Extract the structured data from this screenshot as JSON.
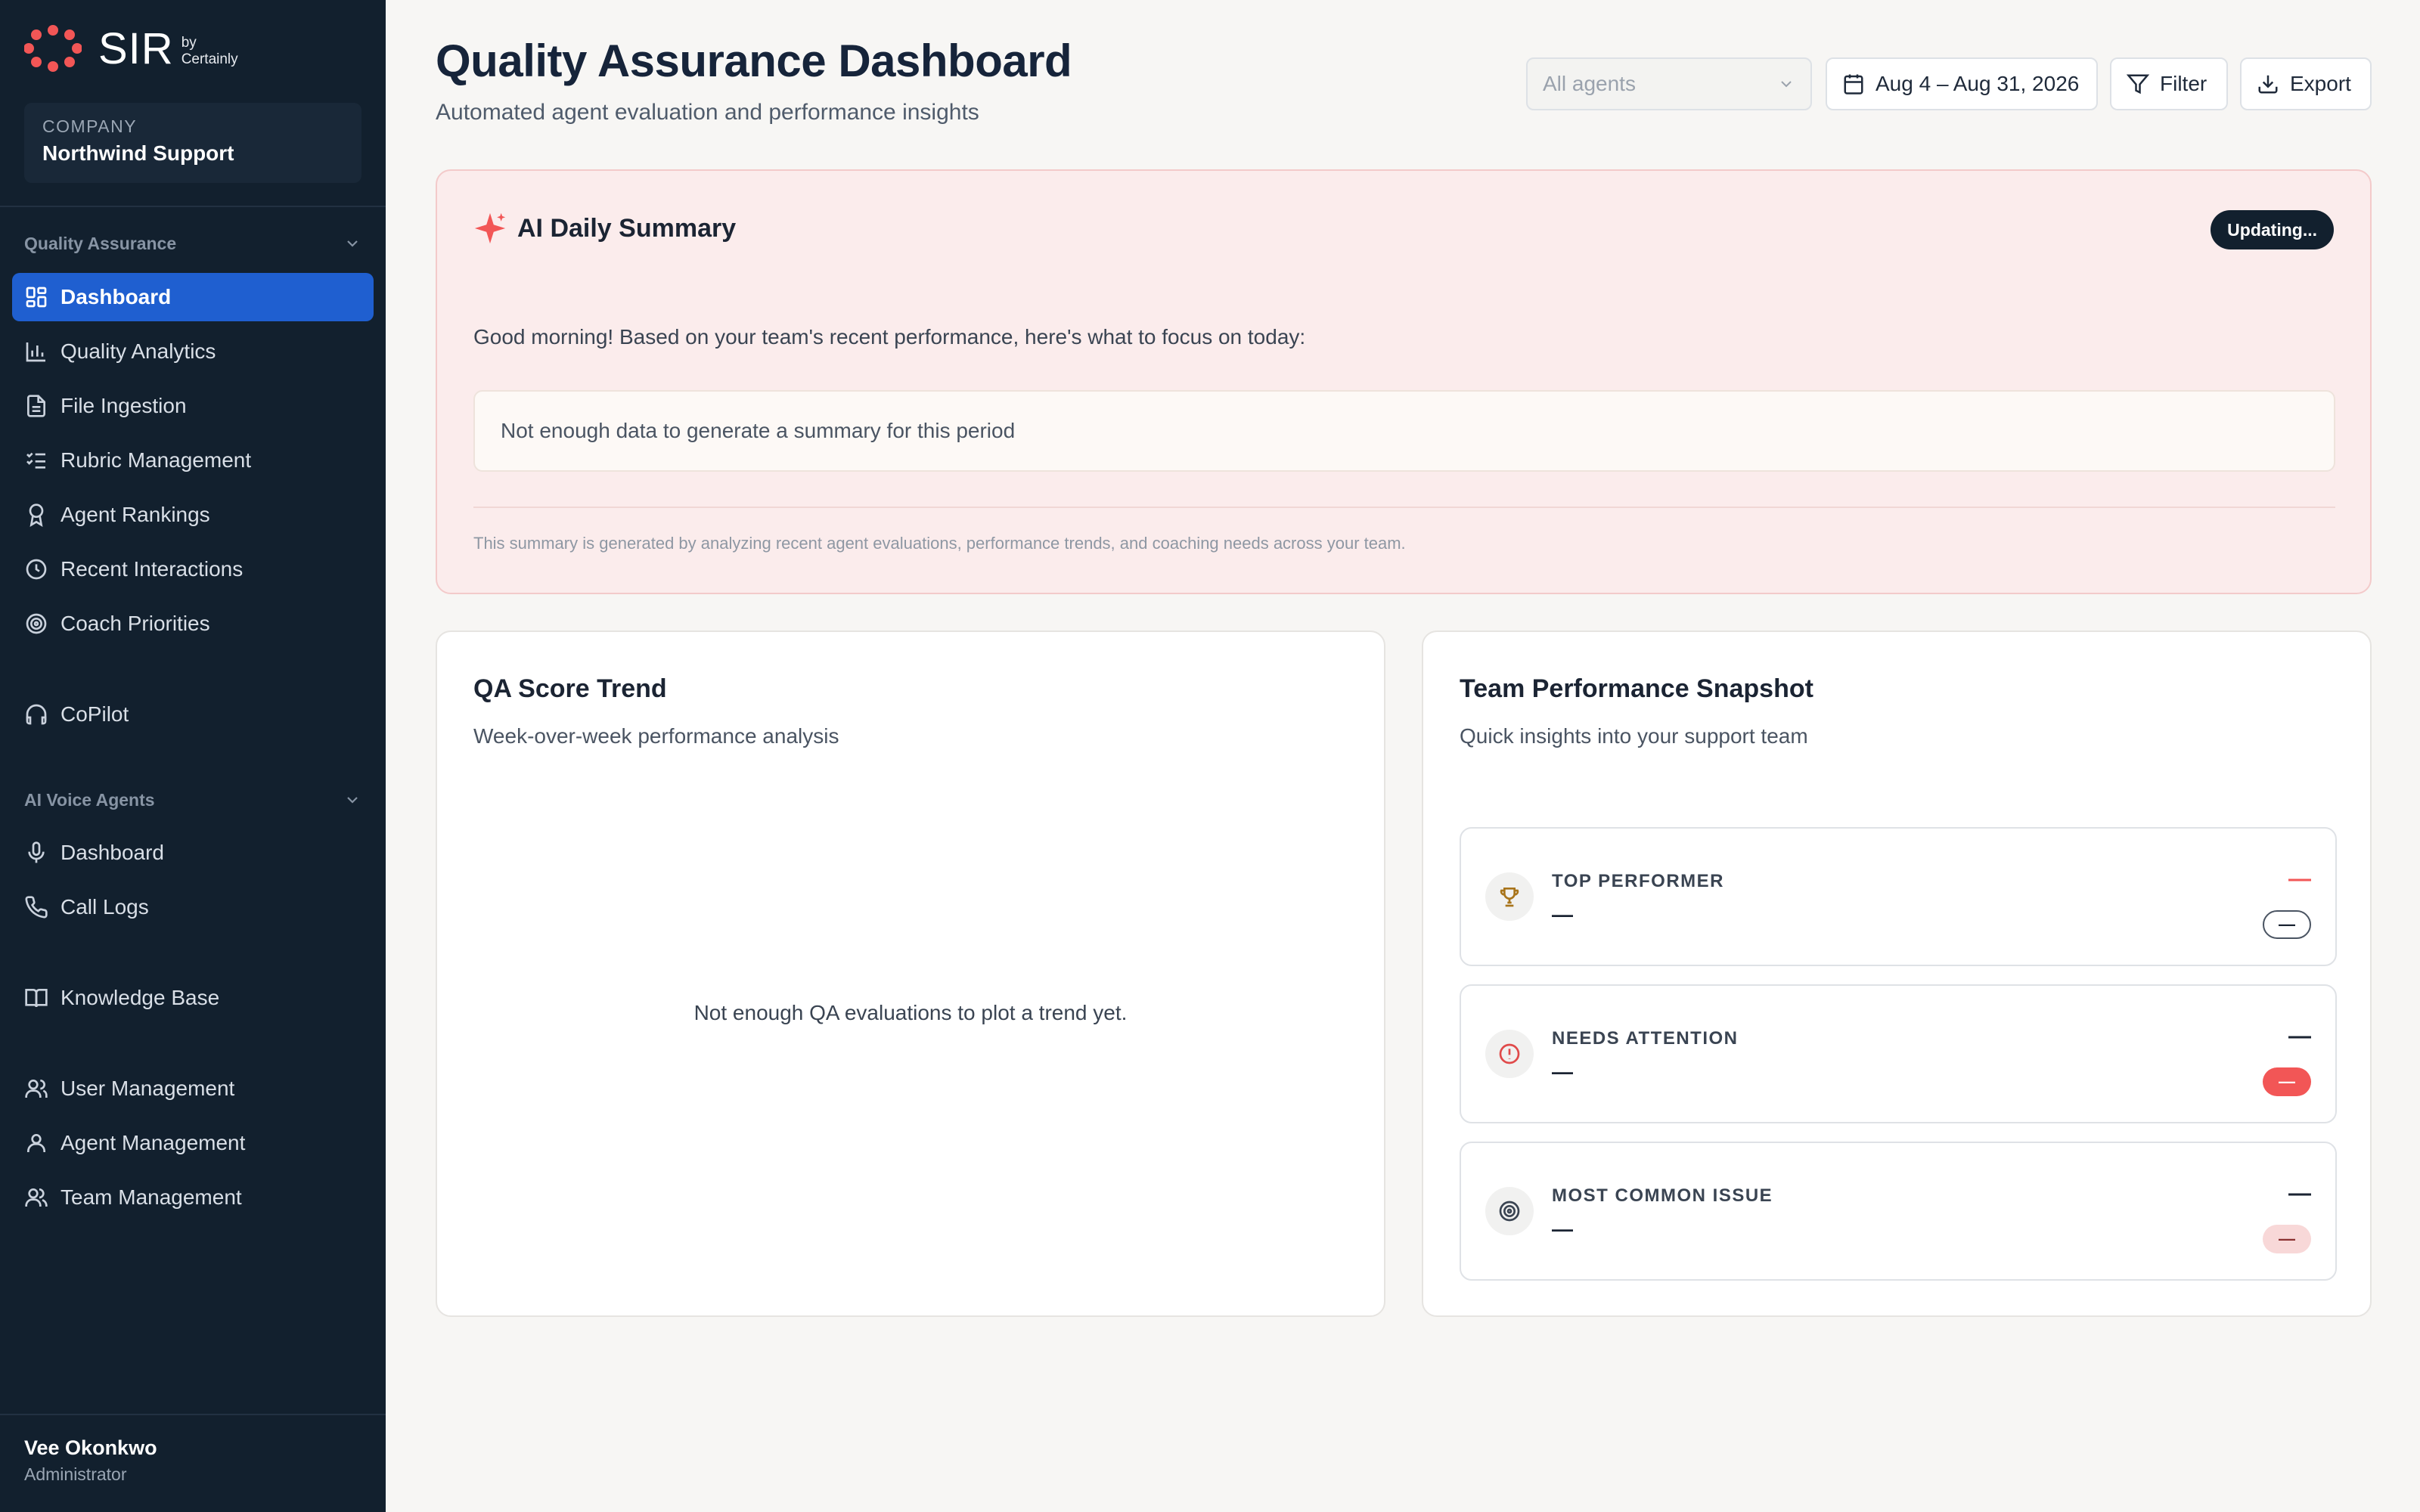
{
  "brand": {
    "name": "SIR",
    "by": "by",
    "vendor": "Certainly"
  },
  "company": {
    "label": "COMPANY",
    "name": "Northwind Support"
  },
  "sidebar": {
    "qa_section": "Quality Assurance",
    "qa_items": [
      {
        "label": "Dashboard",
        "icon": "grid-icon",
        "active": true
      },
      {
        "label": "Quality Analytics",
        "icon": "bar-chart-icon"
      },
      {
        "label": "File Ingestion",
        "icon": "file-icon"
      },
      {
        "label": "Rubric Management",
        "icon": "checklist-icon"
      },
      {
        "label": "Agent Rankings",
        "icon": "award-icon"
      },
      {
        "label": "Recent Interactions",
        "icon": "clock-icon"
      },
      {
        "label": "Coach Priorities",
        "icon": "target-icon"
      }
    ],
    "copilot": "CoPilot",
    "voice_section": "AI Voice Agents",
    "voice_items": [
      {
        "label": "Dashboard",
        "icon": "mic-icon"
      },
      {
        "label": "Call Logs",
        "icon": "phone-icon"
      }
    ],
    "knowledge_base": "Knowledge Base",
    "admin_items": [
      {
        "label": "User Management",
        "icon": "users-icon"
      },
      {
        "label": "Agent Management",
        "icon": "user-icon"
      },
      {
        "label": "Team Management",
        "icon": "team-icon"
      }
    ]
  },
  "user": {
    "name": "Vee Okonkwo",
    "role": "Administrator"
  },
  "header": {
    "title": "Quality Assurance Dashboard",
    "subtitle": "Automated agent evaluation and performance insights",
    "agent_select": "All agents",
    "date_range": "Aug 4 – Aug 31, 2026",
    "filter": "Filter",
    "export": "Export"
  },
  "summary": {
    "title": "AI Daily Summary",
    "badge": "Updating...",
    "greeting": "Good morning! Based on your team's recent performance, here's what to focus on today:",
    "body": "Not enough data to generate a summary for this period",
    "footnote": "This summary is generated by analyzing recent agent evaluations, performance trends, and coaching needs across your team."
  },
  "trend": {
    "title": "QA Score Trend",
    "subtitle": "Week-over-week performance analysis",
    "empty": "Not enough QA evaluations to plot a trend yet."
  },
  "team": {
    "title": "Team Performance Snapshot",
    "subtitle": "Quick insights into your support team",
    "items": [
      {
        "label": "TOP PERFORMER",
        "value": "—",
        "metric": "—",
        "chip": "—",
        "icon": "trophy-icon",
        "metric_color": "#f25656"
      },
      {
        "label": "NEEDS ATTENTION",
        "value": "—",
        "metric": "—",
        "chip": "—",
        "icon": "alert-circle-icon",
        "metric_color": "#1b2433"
      },
      {
        "label": "MOST COMMON ISSUE",
        "value": "—",
        "metric": "—",
        "chip": "—",
        "icon": "target-icon",
        "metric_color": "#1b2433"
      }
    ]
  },
  "colors": {
    "sidebar_bg": "#12202e",
    "active_nav": "#1f5fd0",
    "brand_red": "#f25656",
    "summary_bg": "#fbecec"
  }
}
